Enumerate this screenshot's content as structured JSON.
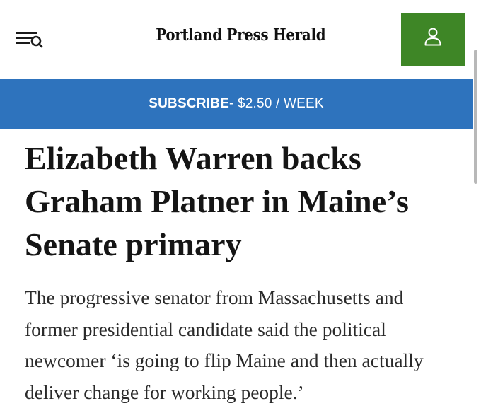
{
  "header": {
    "menu_search_icon": "menu-search-icon",
    "logo_text": "Portland Press Herald",
    "account_icon": "user-icon",
    "account_color": "#3e8626"
  },
  "subscribe_bar": {
    "label": "SUBSCRIBE",
    "price_text": " - $2.50 / WEEK",
    "color": "#2e73bd"
  },
  "article": {
    "headline": "Elizabeth Warren backs Graham Platner in Maine’s Senate primary",
    "dek": "The progressive senator from Massachusetts and former presidential candidate said the political newcomer ‘is going to flip Maine and then actually deliver change for working people.’"
  }
}
